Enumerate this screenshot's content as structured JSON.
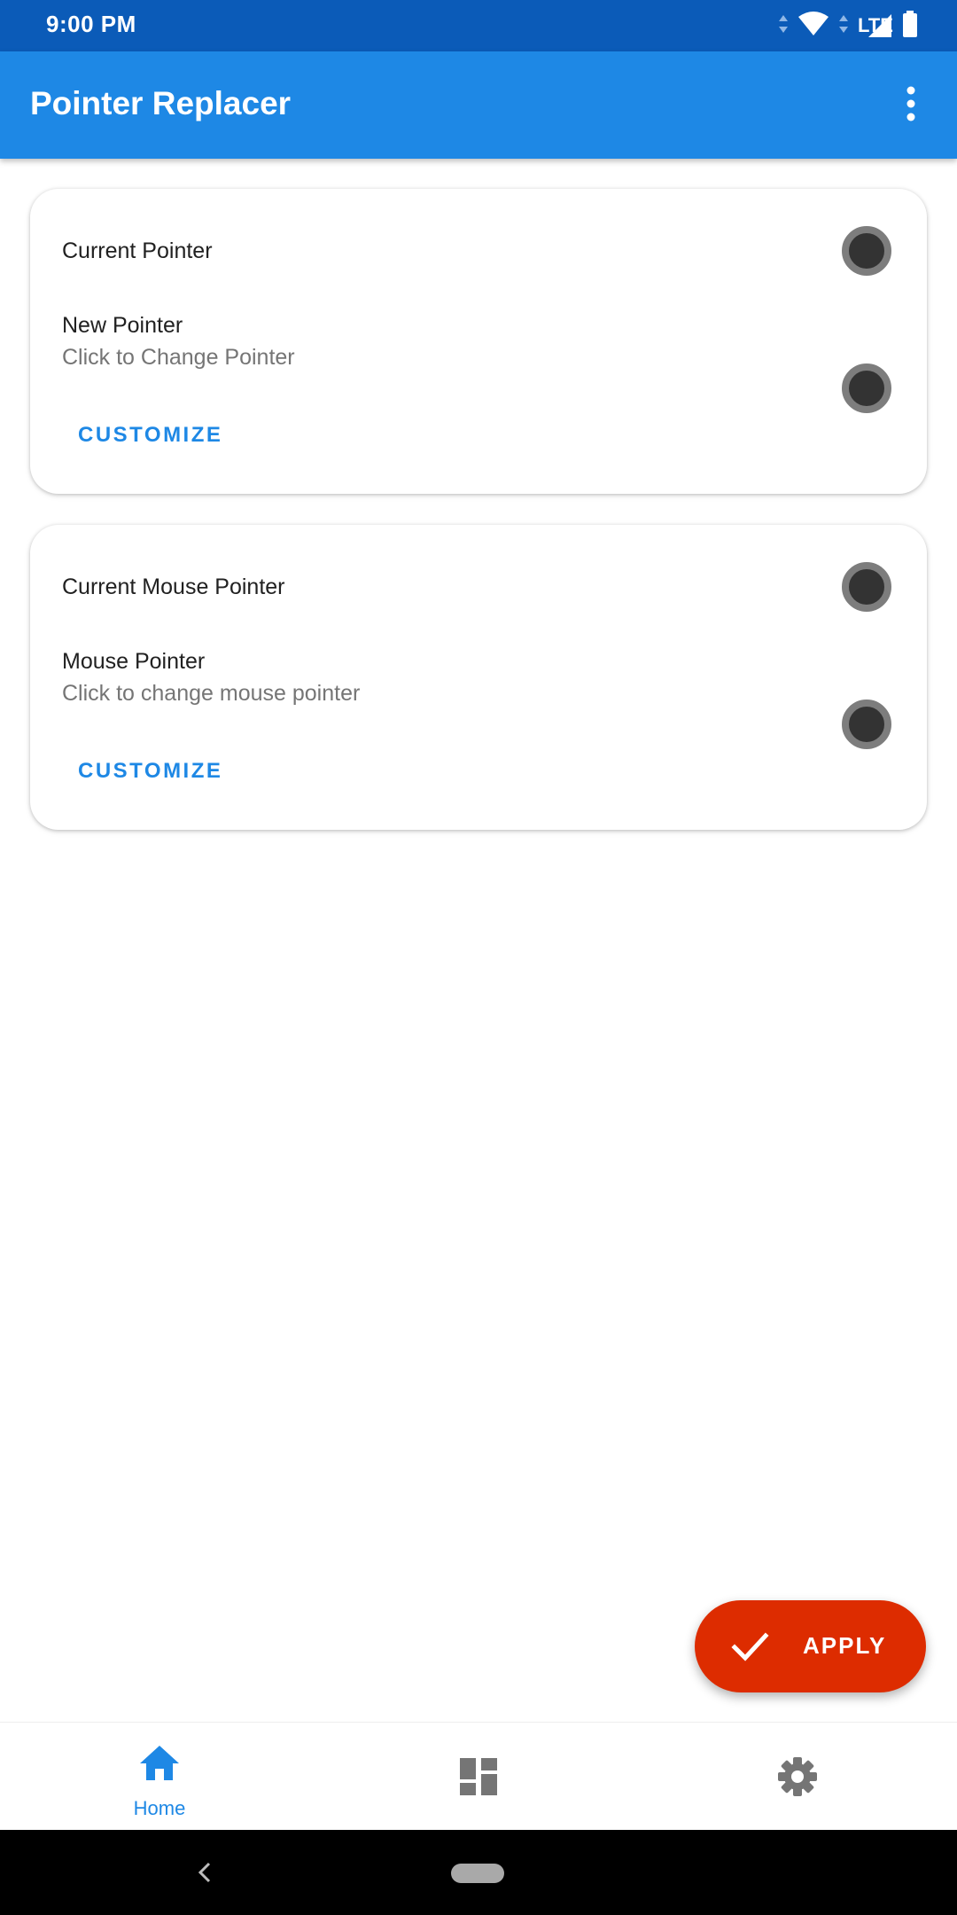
{
  "status_bar": {
    "time": "9:00 PM",
    "network_label": "LTE",
    "icons": [
      "data-arrows-icon",
      "wifi-icon",
      "lte-signal-icon",
      "battery-icon"
    ]
  },
  "app_bar": {
    "title": "Pointer Replacer",
    "menu_icon": "more-vert-icon"
  },
  "pointer_card": {
    "current_label": "Current Pointer",
    "new_label": "New Pointer",
    "new_sub": "Click to Change Pointer",
    "customize_label": "CUSTOMIZE"
  },
  "mouse_card": {
    "current_label": "Current Mouse Pointer",
    "new_label": "Mouse Pointer",
    "new_sub": "Click to change mouse pointer",
    "customize_label": "CUSTOMIZE"
  },
  "fab": {
    "label": "APPLY",
    "icon": "check-icon",
    "color": "#dd2c00"
  },
  "bottom_nav": {
    "items": [
      {
        "label": "Home",
        "icon": "home-icon",
        "active": true
      },
      {
        "label": "",
        "icon": "dashboard-icon",
        "active": false
      },
      {
        "label": "",
        "icon": "settings-icon",
        "active": false
      }
    ]
  },
  "colors": {
    "status_bar": "#0b5bb8",
    "app_bar": "#1e88e5",
    "accent": "#1e88e5",
    "pointer_dot": "#333333",
    "pointer_ring": "#7d7d7d"
  }
}
